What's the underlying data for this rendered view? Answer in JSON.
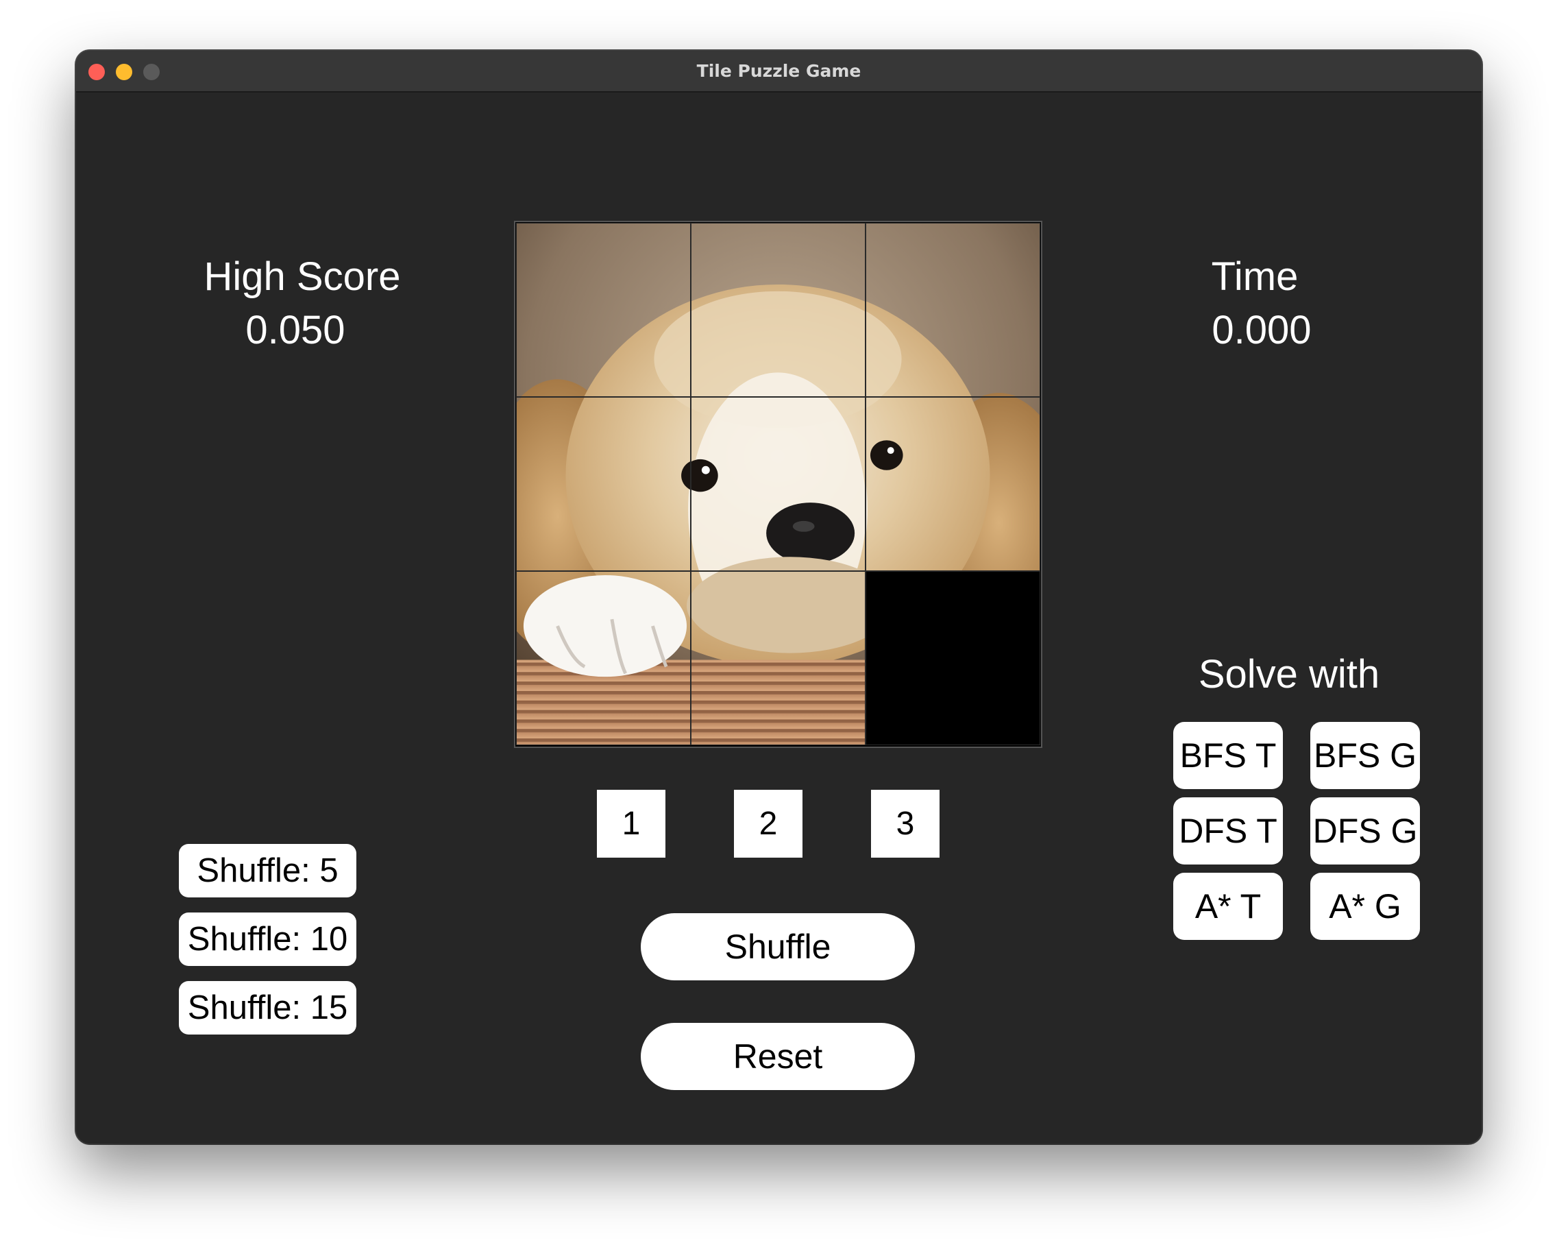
{
  "window": {
    "title": "Tile Puzzle Game"
  },
  "high_score": {
    "label": "High Score",
    "value": "0.050"
  },
  "time": {
    "label": "Time",
    "value": "0.000"
  },
  "board": {
    "image": "puppy-photo",
    "grid_size": 3,
    "tiles": [
      {
        "piece": 1
      },
      {
        "piece": 2
      },
      {
        "piece": 3
      },
      {
        "piece": 4
      },
      {
        "piece": 5
      },
      {
        "piece": 6
      },
      {
        "piece": 7
      },
      {
        "piece": 8
      },
      {
        "piece": 0
      }
    ],
    "empty_color": "#000000"
  },
  "grid_size_buttons": [
    "1",
    "2",
    "3"
  ],
  "actions": {
    "shuffle": "Shuffle",
    "reset": "Reset"
  },
  "shuffle_presets": [
    "Shuffle: 5",
    "Shuffle: 10",
    "Shuffle: 15"
  ],
  "solve": {
    "label": "Solve with",
    "buttons": [
      "BFS T",
      "BFS G",
      "DFS T",
      "DFS G",
      "A* T",
      "A* G"
    ]
  },
  "colors": {
    "background": "#262626",
    "titlebar": "#373737",
    "button": "#ffffff",
    "text": "#ffffff"
  }
}
